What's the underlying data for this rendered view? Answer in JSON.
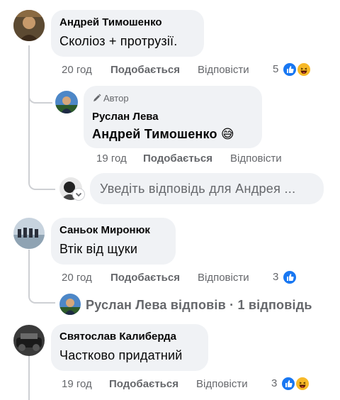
{
  "colors": {
    "bubble_bg": "#f0f2f5",
    "meta_text": "#65676b",
    "like_blue": "#1877f2",
    "haha_yellow": "#f7b928",
    "thread_line": "#ced0d4"
  },
  "comments": [
    {
      "author": "Андрей Тимошенко",
      "text": "Сколіоз + протрузії.",
      "time": "20 год",
      "like_label": "Подобається",
      "reply_label": "Відповісти",
      "reaction_count": "5",
      "reactions": [
        "like-icon",
        "haha-icon"
      ],
      "reply": {
        "badge_icon": "pencil-icon",
        "badge_label": "Автор",
        "author": "Руслан Лева",
        "text": "Андрей Тимошенко 😅",
        "time": "19 год",
        "like_label": "Подобається",
        "reply_label": "Відповісти"
      },
      "reply_input": {
        "placeholder": "Уведіть відповідь для Андрея ..."
      }
    },
    {
      "author": "Саньок Миронюк",
      "text": "Втік від щуки",
      "time": "20 год",
      "like_label": "Подобається",
      "reply_label": "Відповісти",
      "reaction_count": "3",
      "reactions": [
        "like-icon"
      ],
      "view_replies": "Руслан Лева відповів · 1 відповідь"
    },
    {
      "author": "Святослав Калиберда",
      "text": "Частково придатний",
      "time": "19 год",
      "like_label": "Подобається",
      "reply_label": "Відповісти",
      "reaction_count": "3",
      "reactions": [
        "like-icon",
        "haha-icon"
      ]
    }
  ]
}
